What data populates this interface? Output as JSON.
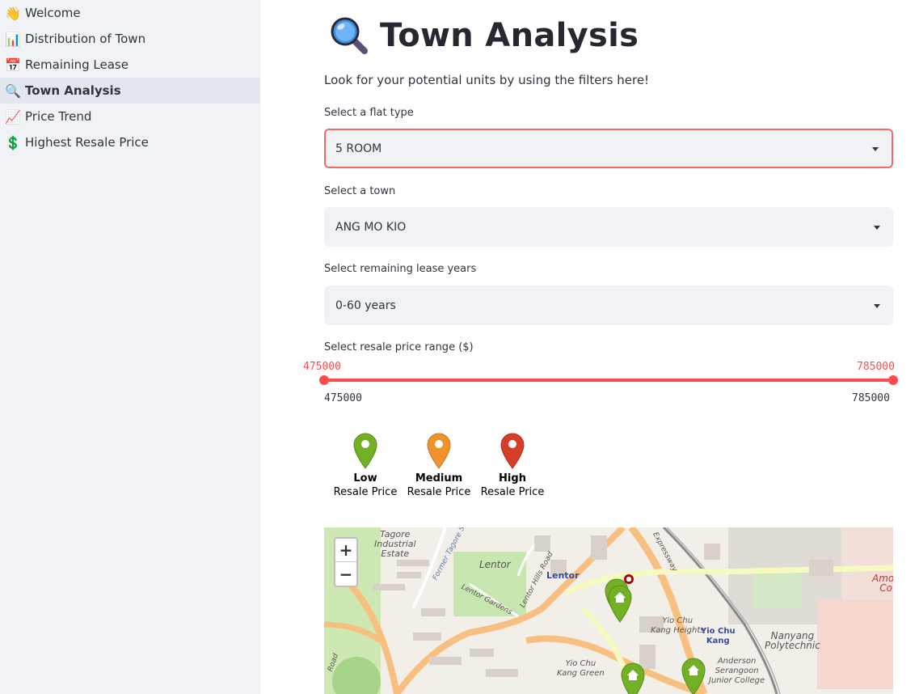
{
  "sidebar": {
    "items": [
      {
        "label": "Welcome",
        "icon": "waving-hand-icon",
        "glyph": "👋"
      },
      {
        "label": "Distribution of Town",
        "icon": "bar-chart-icon",
        "glyph": "📊"
      },
      {
        "label": "Remaining Lease",
        "icon": "calendar-icon",
        "glyph": "📅"
      },
      {
        "label": "Town Analysis",
        "icon": "magnifier-icon",
        "glyph": "🔍",
        "active": true
      },
      {
        "label": "Price Trend",
        "icon": "trend-up-icon",
        "glyph": "📈"
      },
      {
        "label": "Highest Resale Price",
        "icon": "dollar-icon",
        "glyph": "💲"
      }
    ]
  },
  "page": {
    "title": "Town Analysis",
    "title_icon": "magnifier-icon",
    "intro": "Look for your potential units by using the filters here!"
  },
  "filters": {
    "flat_type": {
      "label": "Select a flat type",
      "value": "5 ROOM"
    },
    "town": {
      "label": "Select a town",
      "value": "ANG MO KIO"
    },
    "lease": {
      "label": "Select remaining lease years",
      "value": "0-60 years"
    },
    "price": {
      "label": "Select resale price range ($)",
      "selected_min": "475000",
      "selected_max": "785000",
      "range_min": "475000",
      "range_max": "785000"
    }
  },
  "legend": [
    {
      "level": "Low",
      "sub": "Resale Price",
      "color": "#72b026"
    },
    {
      "level": "Medium",
      "sub": "Resale Price",
      "color": "#f0932f"
    },
    {
      "level": "High",
      "sub": "Resale Price",
      "color": "#d63e2a"
    }
  ],
  "map": {
    "zoom_in": "+",
    "zoom_out": "−",
    "labels": {
      "tagore": "Tagore\nIndustrial\nEstate",
      "lentor": "Lentor",
      "lentor_station": "Lentor",
      "former_tagore": "Former Tagore St",
      "lentor_gardens": "Lentor Gardens",
      "lentor_hills": "Lentor Hills Road",
      "yio_chu_kang_heights": "Yio Chu\nKang Heights",
      "yio_chu_kang_station": "Yio Chu\nKang",
      "yio_chu_kang_green": "Yio Chu\nKang Green",
      "nanyang": "Nanyang\nPolytechnic",
      "anderson": "Anderson\nSerangoon\nJunior College",
      "amoy": "Amoy\nCo",
      "expressway": "Expressway",
      "road": "Road"
    },
    "marker_color": "#72b026"
  }
}
